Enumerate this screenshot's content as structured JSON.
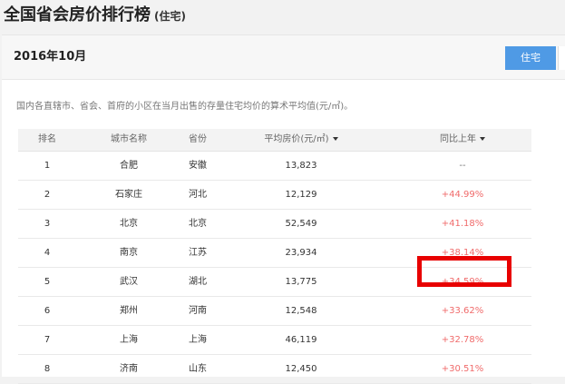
{
  "header": {
    "title": "全国省会房价排行榜",
    "subtitle": "(住宅)"
  },
  "toolbar": {
    "date": "2016年10月",
    "type_button": "住宅"
  },
  "description": "国内各直辖市、省会、首府的小区在当月出售的存量住宅均价的算术平均值(元/㎡)。",
  "table": {
    "columns": {
      "rank": "排名",
      "city": "城市名称",
      "province": "省份",
      "price": "平均房价(元/㎡)",
      "change": "同比上年"
    },
    "rows": [
      {
        "rank": "1",
        "city": "合肥",
        "province": "安徽",
        "price": "13,823",
        "change": "--",
        "trend": "neutral"
      },
      {
        "rank": "2",
        "city": "石家庄",
        "province": "河北",
        "price": "12,129",
        "change": "+44.99%",
        "trend": "up"
      },
      {
        "rank": "3",
        "city": "北京",
        "province": "北京",
        "price": "52,549",
        "change": "+41.18%",
        "trend": "up"
      },
      {
        "rank": "4",
        "city": "南京",
        "province": "江苏",
        "price": "23,934",
        "change": "+38.14%",
        "trend": "up"
      },
      {
        "rank": "5",
        "city": "武汉",
        "province": "湖北",
        "price": "13,775",
        "change": "+34.59%",
        "trend": "up"
      },
      {
        "rank": "6",
        "city": "郑州",
        "province": "河南",
        "price": "12,548",
        "change": "+33.62%",
        "trend": "up"
      },
      {
        "rank": "7",
        "city": "上海",
        "province": "上海",
        "price": "46,119",
        "change": "+32.78%",
        "trend": "up"
      },
      {
        "rank": "8",
        "city": "济南",
        "province": "山东",
        "price": "12,450",
        "change": "+30.51%",
        "trend": "up"
      }
    ]
  },
  "colors": {
    "accent": "#4f9ae5",
    "increase": "#f06b6b",
    "highlight": "#e80000"
  },
  "icons": {
    "sort": "caret-down-icon"
  }
}
